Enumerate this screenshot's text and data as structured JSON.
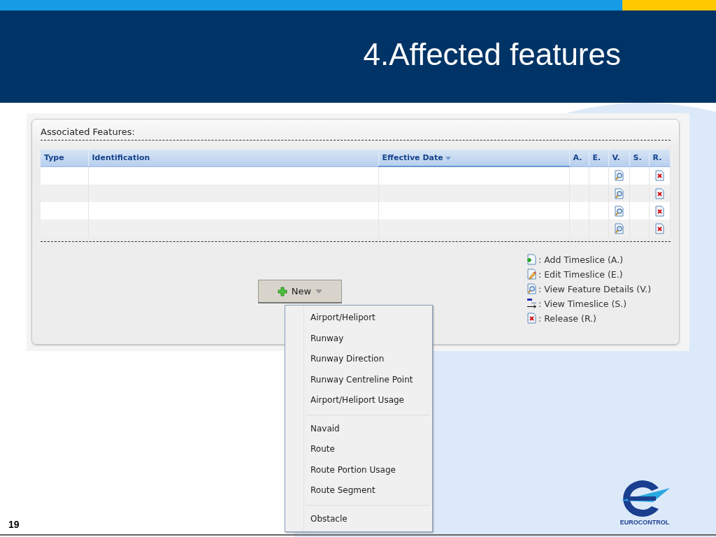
{
  "slide": {
    "title": "4.Affected features",
    "page_number": "19",
    "logo_text": "EUROCONTROL"
  },
  "panel": {
    "title": "Associated Features:",
    "table": {
      "columns": [
        {
          "label": "Type",
          "sorted": false
        },
        {
          "label": "Identification",
          "sorted": false
        },
        {
          "label": "Effective Date",
          "sorted": true
        },
        {
          "label": "A.",
          "sorted": false
        },
        {
          "label": "E.",
          "sorted": false
        },
        {
          "label": "V.",
          "sorted": false
        },
        {
          "label": "S.",
          "sorted": false
        },
        {
          "label": "R.",
          "sorted": false
        }
      ],
      "rows": [
        {
          "has_view": true,
          "has_release": true
        },
        {
          "has_view": true,
          "has_release": true
        },
        {
          "has_view": true,
          "has_release": true
        },
        {
          "has_view": true,
          "has_release": true
        }
      ]
    },
    "legend": [
      {
        "kind": "add",
        "label": ": Add Timeslice (A.)"
      },
      {
        "kind": "edit",
        "label": ": Edit Timeslice (E.)"
      },
      {
        "kind": "view",
        "label": ": View Feature Details (V.)"
      },
      {
        "kind": "timeslice",
        "label": ": View Timeslice (S.)"
      },
      {
        "kind": "release",
        "label": ": Release (R.)"
      }
    ],
    "new_button": {
      "label": "New",
      "expanded": true
    },
    "menu": {
      "groups": [
        {
          "items": [
            "Airport/Heliport",
            "Runway",
            "Runway Direction",
            "Runway Centreline Point",
            "Airport/Heliport Usage"
          ]
        },
        {
          "items": [
            "Navaid",
            "Route",
            "Route Portion Usage",
            "Route Segment"
          ]
        },
        {
          "items": [
            "Obstacle"
          ]
        }
      ]
    }
  }
}
